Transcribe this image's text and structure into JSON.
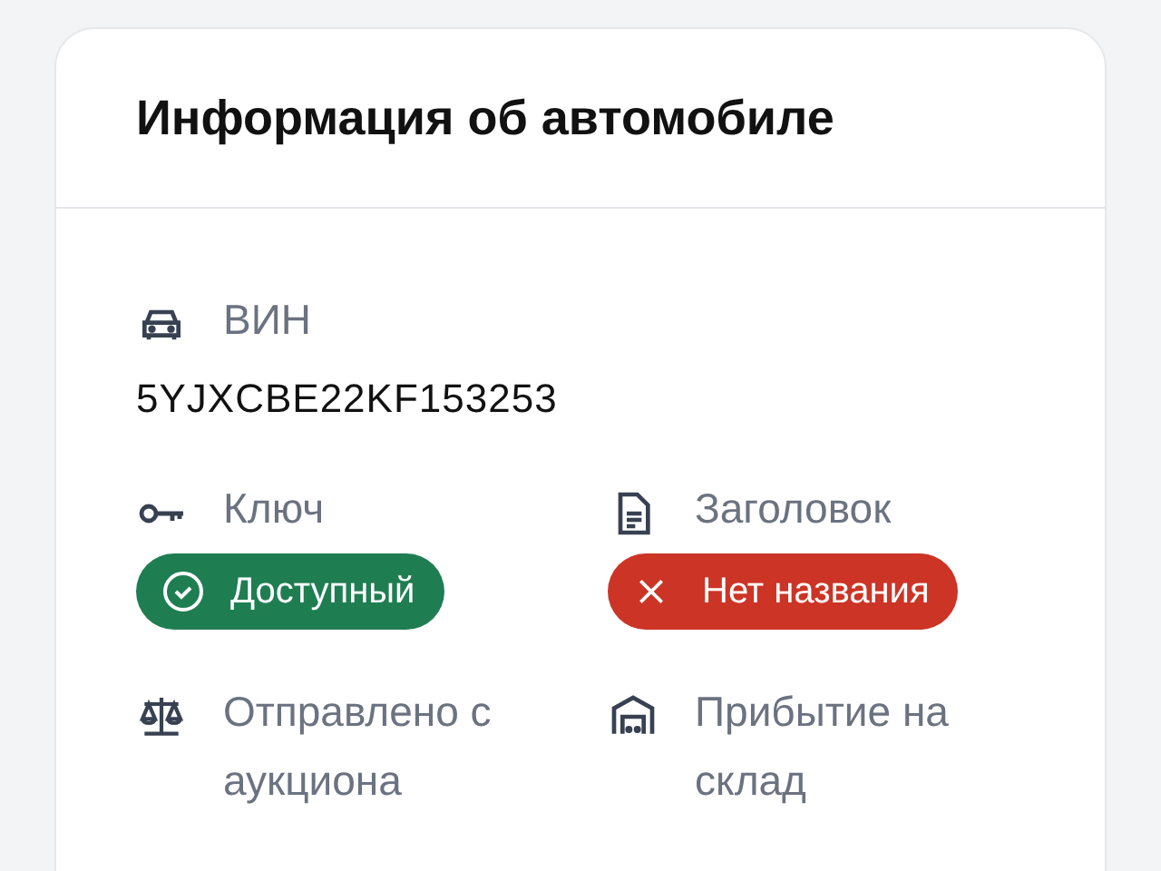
{
  "card": {
    "title": "Информация об автомобиле"
  },
  "vin": {
    "label": "ВИН",
    "value": "5YJXCBE22KF153253"
  },
  "fields": [
    {
      "kind": "key",
      "label": "Ключ",
      "badge": {
        "kind": "ok",
        "text": "Доступный"
      }
    },
    {
      "kind": "document",
      "label": "Заголовок",
      "badge": {
        "kind": "error",
        "text": "Нет названия"
      }
    },
    {
      "kind": "scale",
      "label": "Отправлено с аукциона"
    },
    {
      "kind": "garage",
      "label": "Прибытие на склад"
    }
  ]
}
